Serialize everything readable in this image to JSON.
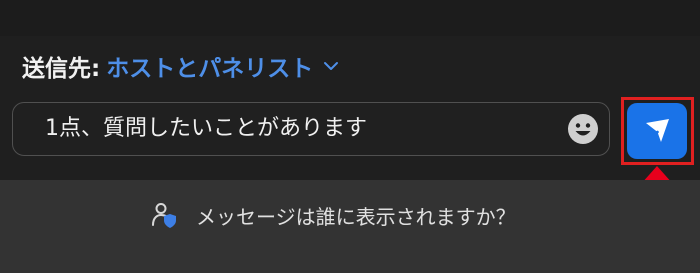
{
  "composer": {
    "recipient_label": "送信先:",
    "recipient_value": "ホストとパネリスト",
    "message_text": "1点、質問したいことがあります"
  },
  "info": {
    "text": "メッセージは誰に表示されますか？"
  },
  "icons": {
    "recipient_dropdown": "chevron-down-icon",
    "emoji": "emoji-icon",
    "send": "send-icon",
    "visibility": "user-shield-icon",
    "annotation": "up-arrow-annotation"
  },
  "colors": {
    "accent": "#4e8fe8",
    "send_button": "#1a73e8",
    "highlight": "#e02020",
    "background": "#1f1f1f",
    "footer": "#333333"
  }
}
